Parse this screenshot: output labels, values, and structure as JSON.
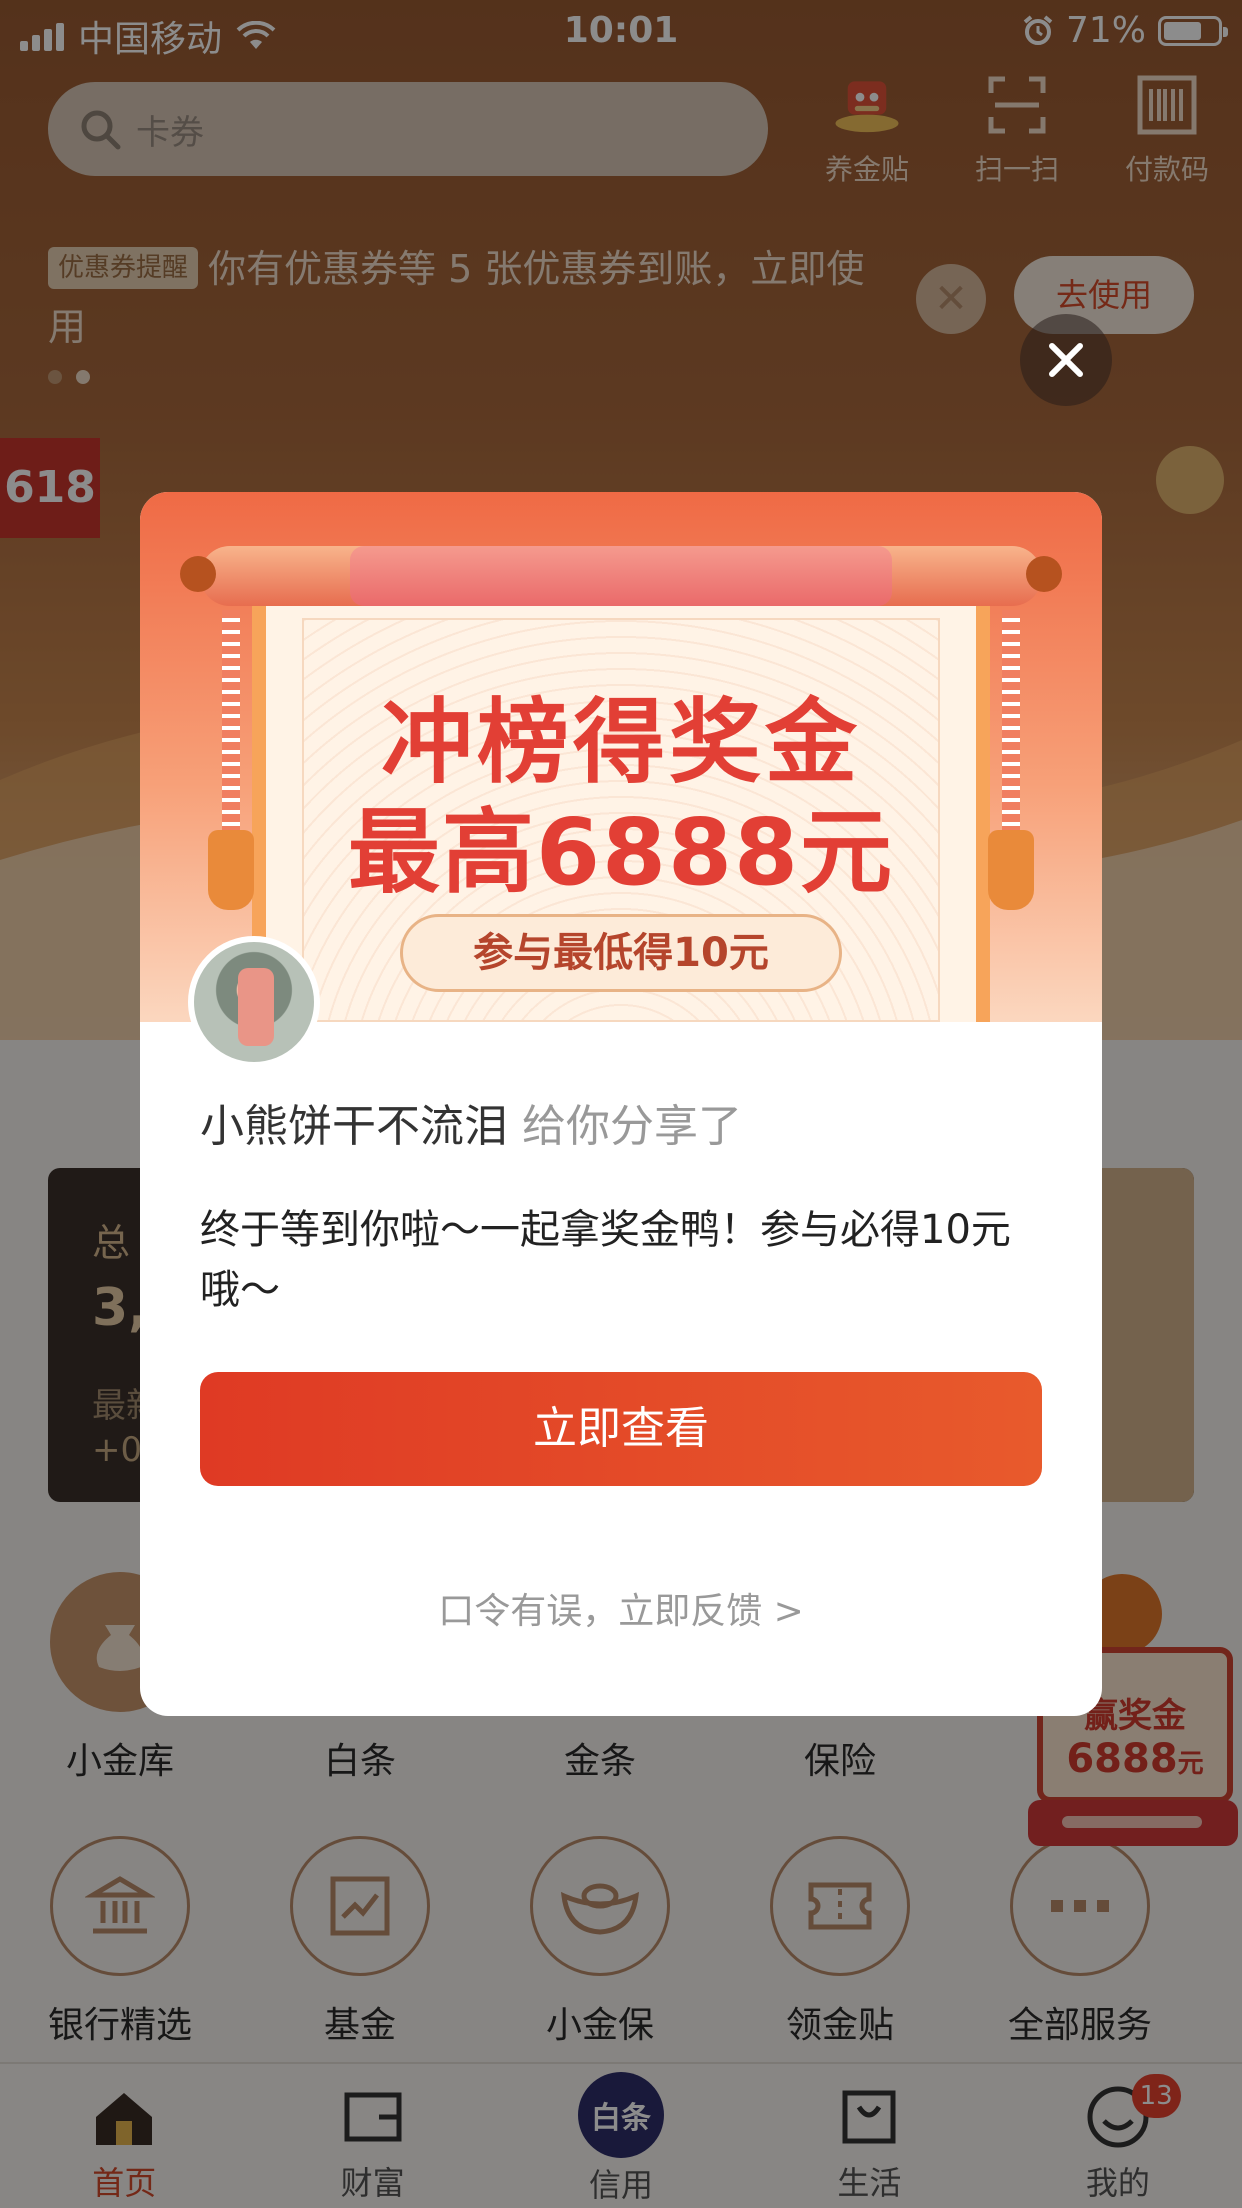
{
  "status_bar": {
    "carrier": "中国移动",
    "time": "10:01",
    "battery": "71%",
    "battery_level": 0.71
  },
  "search": {
    "placeholder": "卡券"
  },
  "top_actions": [
    {
      "label": "养金贴",
      "icon": "mascot-icon"
    },
    {
      "label": "扫一扫",
      "icon": "scan-icon"
    },
    {
      "label": "付款码",
      "icon": "barcode-icon"
    }
  ],
  "notice": {
    "tag": "优惠券提醒",
    "text": "你有优惠券等 5 张优惠券到账，立即使用",
    "action": "去使用"
  },
  "banner": {
    "badge": "618"
  },
  "assets": {
    "title": "总",
    "amount": "3,0",
    "label": "最新",
    "change": "+0"
  },
  "services_row1": [
    "小金库",
    "白条",
    "金条",
    "保险"
  ],
  "services_row2": [
    "银行精选",
    "基金",
    "小金保",
    "领金贴",
    "全部服务"
  ],
  "float_promo": {
    "line1": "赢奖金",
    "line2": "6888",
    "unit": "元"
  },
  "tabs": [
    {
      "label": "首页",
      "icon": "home-icon"
    },
    {
      "label": "财富",
      "icon": "wallet-icon"
    },
    {
      "label": "信用",
      "icon": "credit-icon",
      "icon_text": "白条"
    },
    {
      "label": "生活",
      "icon": "bag-icon"
    },
    {
      "label": "我的",
      "icon": "profile-icon",
      "badge": "13"
    }
  ],
  "modal": {
    "hero_line1": "冲榜得奖金",
    "hero_line2": "最高6888元",
    "hero_pill": "参与最低得10元",
    "sharer": "小熊饼干不流泪",
    "share_suffix": " 给你分享了",
    "message": "终于等到你啦～一起拿奖金鸭！参与必得10元哦～",
    "primary_button": "立即查看",
    "feedback_link": "口令有误，立即反馈 >"
  },
  "colors": {
    "accent": "#e23f35",
    "button": "#df3a24",
    "brand_brown": "#9a5b32"
  }
}
